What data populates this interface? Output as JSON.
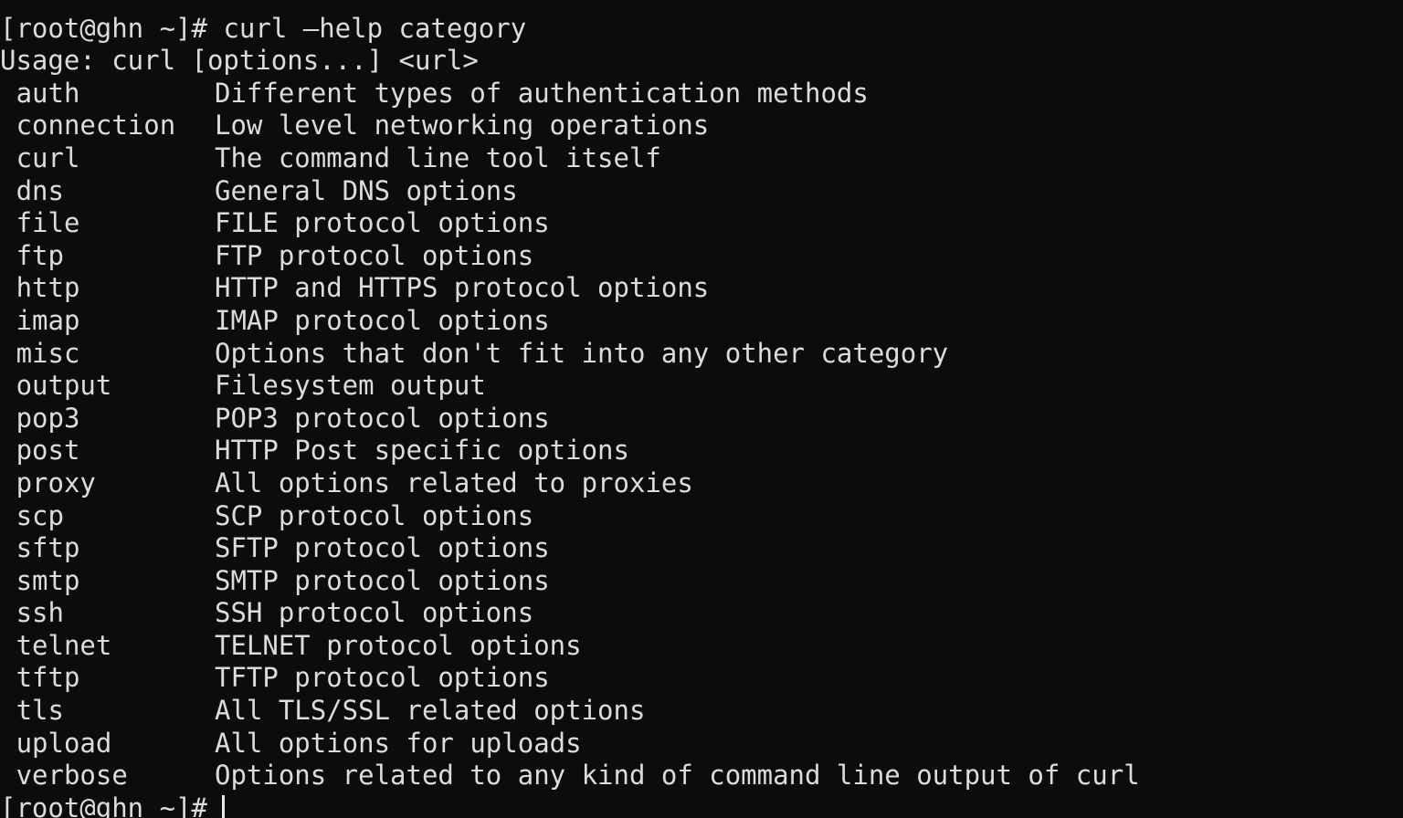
{
  "terminal": {
    "background_color": "#0c0c0c",
    "foreground_color": "#dcdcdc",
    "cursor_color": "#e8e8e8",
    "partial_scrollback_line": " ",
    "prompt": "[root@ghn ~]#",
    "command": " curl –help category",
    "usage_line": "Usage: curl [options...] <url>",
    "final_prompt": "[root@ghn ~]#",
    "categories": [
      {
        "name": "auth",
        "description": "Different types of authentication methods"
      },
      {
        "name": "connection",
        "description": "Low level networking operations"
      },
      {
        "name": "curl",
        "description": "The command line tool itself"
      },
      {
        "name": "dns",
        "description": "General DNS options"
      },
      {
        "name": "file",
        "description": "FILE protocol options"
      },
      {
        "name": "ftp",
        "description": "FTP protocol options"
      },
      {
        "name": "http",
        "description": "HTTP and HTTPS protocol options"
      },
      {
        "name": "imap",
        "description": "IMAP protocol options"
      },
      {
        "name": "misc",
        "description": "Options that don't fit into any other category"
      },
      {
        "name": "output",
        "description": "Filesystem output"
      },
      {
        "name": "pop3",
        "description": "POP3 protocol options"
      },
      {
        "name": "post",
        "description": "HTTP Post specific options"
      },
      {
        "name": "proxy",
        "description": "All options related to proxies"
      },
      {
        "name": "scp",
        "description": "SCP protocol options"
      },
      {
        "name": "sftp",
        "description": "SFTP protocol options"
      },
      {
        "name": "smtp",
        "description": "SMTP protocol options"
      },
      {
        "name": "ssh",
        "description": "SSH protocol options"
      },
      {
        "name": "telnet",
        "description": "TELNET protocol options"
      },
      {
        "name": "tftp",
        "description": "TFTP protocol options"
      },
      {
        "name": "tls",
        "description": "All TLS/SSL related options"
      },
      {
        "name": "upload",
        "description": "All options for uploads"
      },
      {
        "name": "verbose",
        "description": "Options related to any kind of command line output of curl"
      }
    ]
  }
}
